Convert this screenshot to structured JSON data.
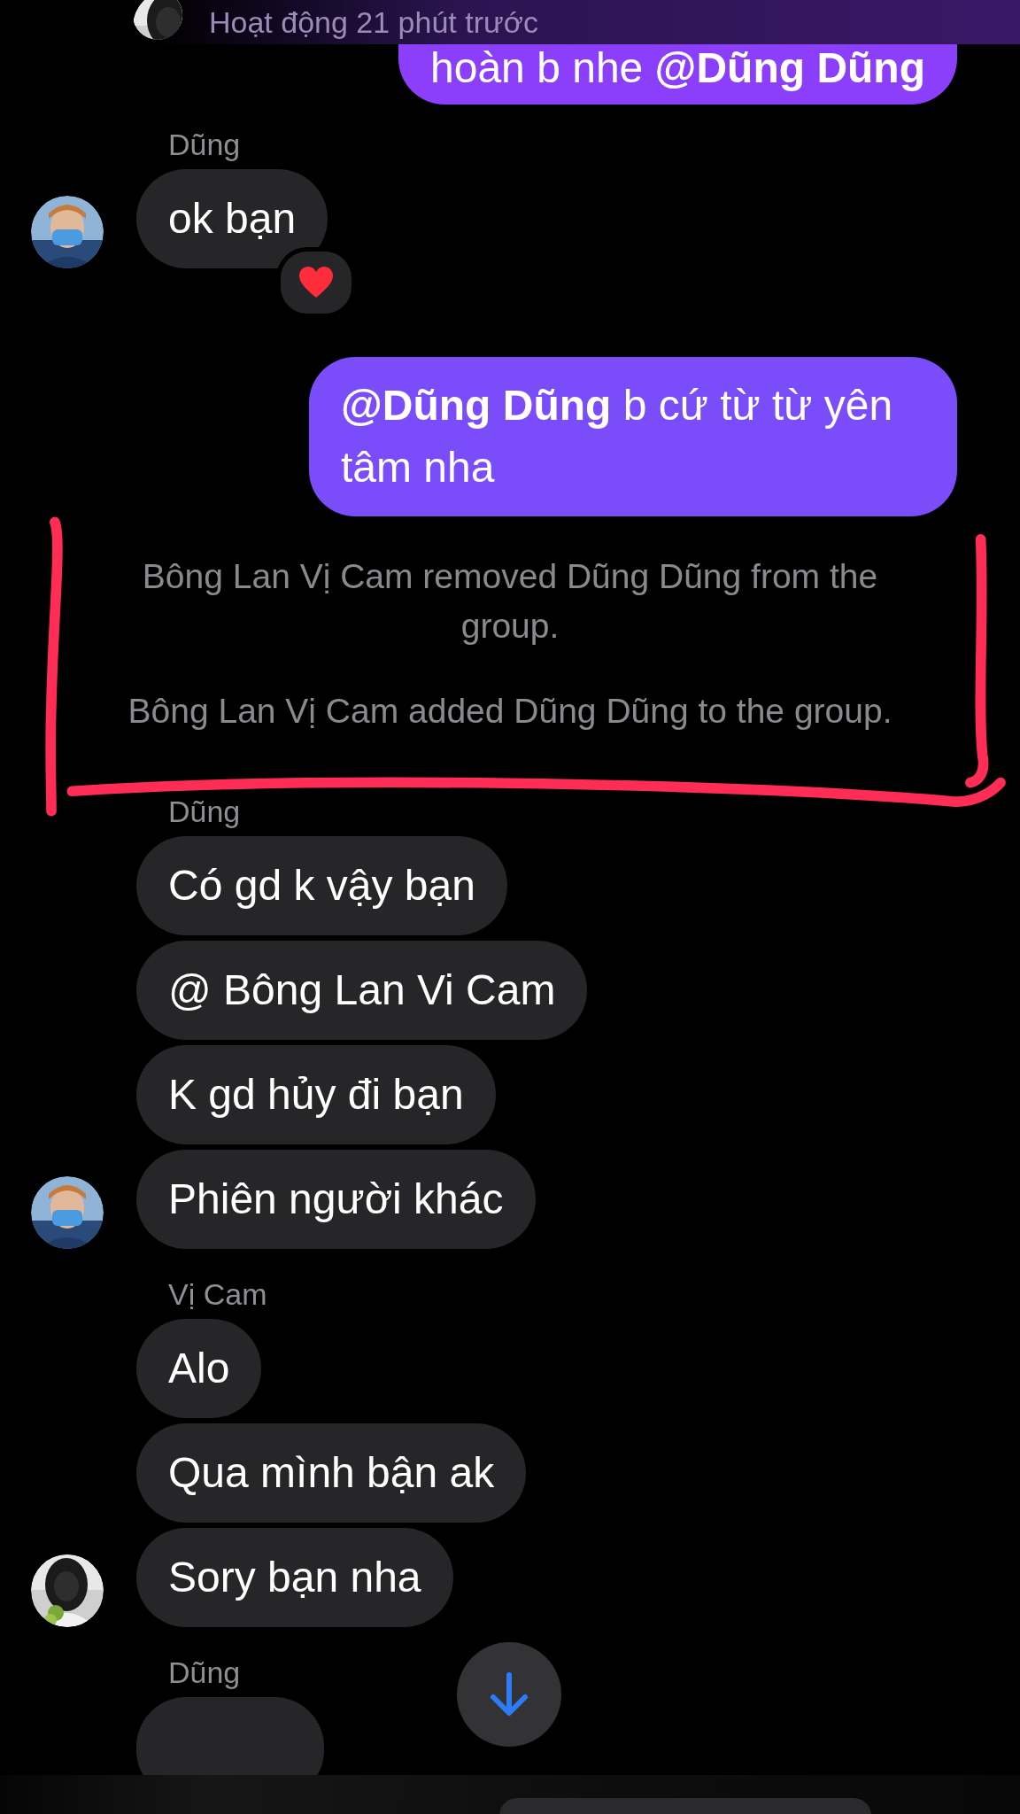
{
  "header": {
    "status": "Hoạt động 21 phút trước"
  },
  "items": [
    {
      "kind": "outgoing",
      "text": "hoàn b nhe **@Dũng Dũng**"
    },
    {
      "kind": "incoming",
      "sender": "Dũng",
      "bubbles": [
        {
          "kind": "text",
          "text": "ok bạn",
          "reacted": true
        }
      ]
    },
    {
      "kind": "outgoing",
      "text": "**@Dũng Dũng** b cứ từ từ yên tâm nha"
    },
    {
      "kind": "system",
      "text": "Bông Lan Vị Cam removed Dũng Dũng from the group."
    },
    {
      "kind": "system",
      "text": "Bông Lan Vị Cam added Dũng Dũng to the group."
    },
    {
      "kind": "incoming",
      "sender": "Dũng",
      "bubbles": [
        {
          "kind": "text",
          "text": "Có gd k vậy bạn"
        },
        {
          "kind": "text",
          "text": "@ Bông Lan Vi Cam"
        },
        {
          "kind": "text",
          "text": "K gd hủy đi bạn"
        },
        {
          "kind": "text",
          "text": "Phiên người khác"
        }
      ]
    },
    {
      "kind": "incoming",
      "sender": "Vị Cam",
      "bubbles": [
        {
          "kind": "text",
          "text": "Alo"
        },
        {
          "kind": "text",
          "text": "Qua mình bận ak"
        },
        {
          "kind": "text",
          "text": "Sory bạn nha"
        }
      ]
    },
    {
      "kind": "incoming",
      "sender": "Dũng",
      "bubbles": [
        {
          "kind": "cut"
        }
      ]
    }
  ]
}
